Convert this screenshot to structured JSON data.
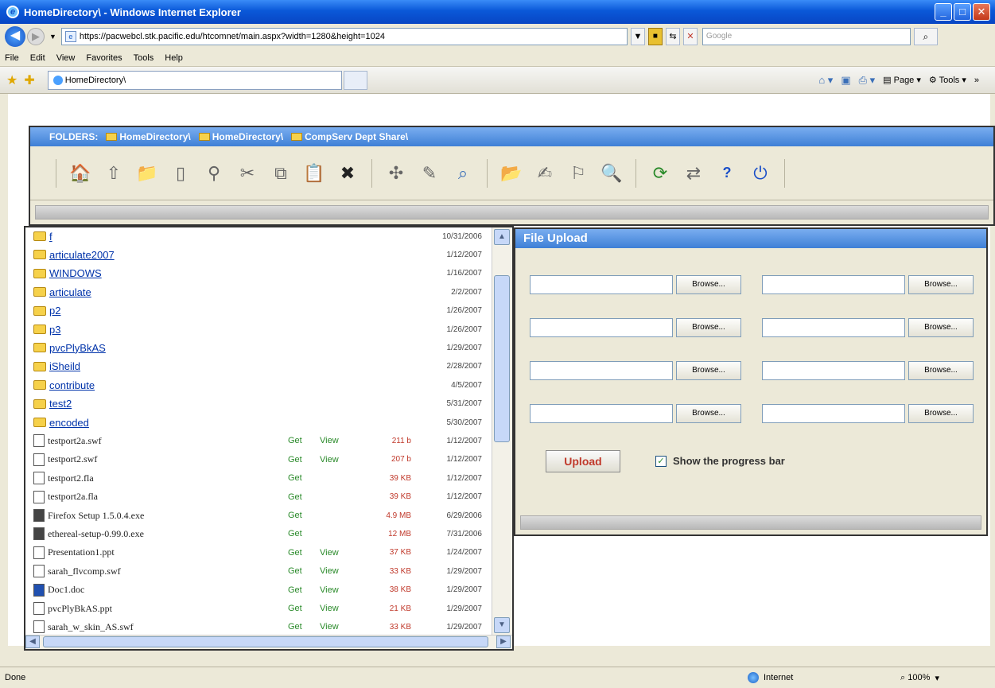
{
  "window": {
    "title": "HomeDirectory\\    - Windows Internet Explorer"
  },
  "address_bar": {
    "url": "https://pacwebcl.stk.pacific.edu/htcomnet/main.aspx?width=1280&height=1024",
    "search_placeholder": "Google"
  },
  "menu": [
    "File",
    "Edit",
    "View",
    "Favorites",
    "Tools",
    "Help"
  ],
  "tab": {
    "label": "HomeDirectory\\"
  },
  "command_bar": {
    "page_label": "Page",
    "tools_label": "Tools"
  },
  "folders": {
    "label": "FOLDERS:",
    "crumbs": [
      "HomeDirectory\\",
      "HomeDirectory\\",
      "CompServ Dept Share\\"
    ]
  },
  "toolbar_icons": [
    "home-directory-icon",
    "up-folder-icon",
    "new-folder-icon",
    "new-file-icon",
    "binoculars-icon",
    "cut-icon",
    "copy-icon",
    "paste-icon",
    "delete-icon",
    "move-icon",
    "rename-icon",
    "search-icon",
    "folder-properties-icon",
    "edit-permissions-icon",
    "share-icon",
    "search-folder-icon",
    "refresh-icon",
    "sync-icon",
    "help-icon",
    "power-icon"
  ],
  "file_list": {
    "get_label": "Get",
    "view_label": "View",
    "folders": [
      {
        "name": "f",
        "date": "10/31/2006"
      },
      {
        "name": "articulate2007",
        "date": "1/12/2007"
      },
      {
        "name": "WINDOWS",
        "date": "1/16/2007"
      },
      {
        "name": "articulate",
        "date": "2/2/2007"
      },
      {
        "name": "p2",
        "date": "1/26/2007"
      },
      {
        "name": "p3",
        "date": "1/26/2007"
      },
      {
        "name": "pvcPlyBkAS",
        "date": "1/29/2007"
      },
      {
        "name": "iSheild",
        "date": "2/28/2007"
      },
      {
        "name": "contribute",
        "date": "4/5/2007"
      },
      {
        "name": "test2",
        "date": "5/31/2007"
      },
      {
        "name": "encoded",
        "date": "5/30/2007"
      }
    ],
    "files": [
      {
        "name": "testport2a.swf",
        "view": true,
        "size": "211 b",
        "date": "1/12/2007"
      },
      {
        "name": "testport2.swf",
        "view": true,
        "size": "207 b",
        "date": "1/12/2007"
      },
      {
        "name": "testport2.fla",
        "view": false,
        "size": "39 KB",
        "date": "1/12/2007"
      },
      {
        "name": "testport2a.fla",
        "view": false,
        "size": "39 KB",
        "date": "1/12/2007"
      },
      {
        "name": "Firefox Setup 1.5.0.4.exe",
        "view": false,
        "size": "4.9 MB",
        "date": "6/29/2006"
      },
      {
        "name": "ethereal-setup-0.99.0.exe",
        "view": false,
        "size": "12 MB",
        "date": "7/31/2006"
      },
      {
        "name": "Presentation1.ppt",
        "view": true,
        "size": "37 KB",
        "date": "1/24/2007"
      },
      {
        "name": "sarah_flvcomp.swf",
        "view": true,
        "size": "33 KB",
        "date": "1/29/2007"
      },
      {
        "name": "Doc1.doc",
        "view": true,
        "size": "38 KB",
        "date": "1/29/2007"
      },
      {
        "name": "pvcPlyBkAS.ppt",
        "view": true,
        "size": "21 KB",
        "date": "1/29/2007"
      },
      {
        "name": "sarah_w_skin_AS.swf",
        "view": true,
        "size": "33 KB",
        "date": "1/29/2007"
      }
    ]
  },
  "upload": {
    "title": "File Upload",
    "browse_label": "Browse...",
    "upload_label": "Upload",
    "progress_label": "Show the progress bar",
    "show_progress": true
  },
  "status": {
    "left": "Done",
    "zone": "Internet",
    "zoom": "100%"
  }
}
